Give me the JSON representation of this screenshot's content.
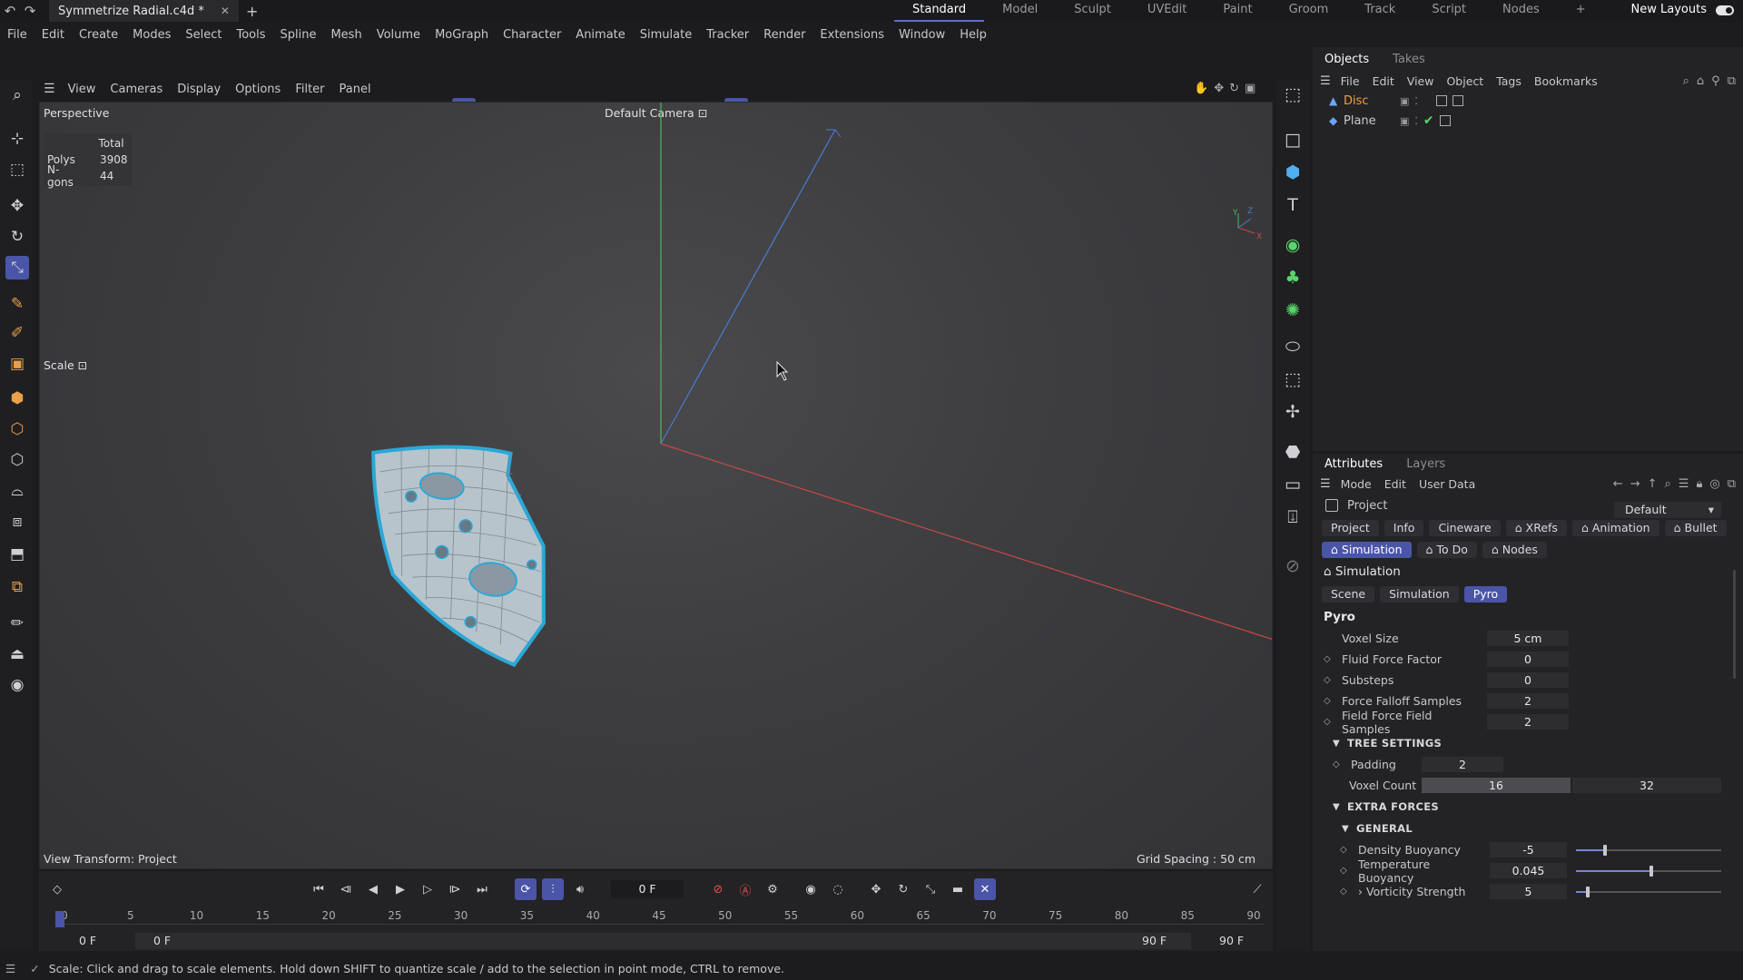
{
  "window": {
    "doc_tab": "Symmetrize Radial.c4d *",
    "layouts": [
      "Standard",
      "Model",
      "Sculpt",
      "UVEdit",
      "Paint",
      "Groom",
      "Track",
      "Script",
      "Nodes"
    ],
    "active_layout": "Standard",
    "new_layouts": "New Layouts"
  },
  "menu": [
    "File",
    "Edit",
    "Create",
    "Modes",
    "Select",
    "Tools",
    "Spline",
    "Mesh",
    "Volume",
    "MoGraph",
    "Character",
    "Animate",
    "Simulate",
    "Tracker",
    "Render",
    "Extensions",
    "Window",
    "Help"
  ],
  "toolbar": {
    "axis_x": "X",
    "axis_y": "Y",
    "axis_z": "Z"
  },
  "viewport": {
    "menu": [
      "View",
      "Cameras",
      "Display",
      "Options",
      "Filter",
      "Panel"
    ],
    "name": "Perspective",
    "camera": "Default Camera",
    "stats_header": "Total",
    "stats": [
      {
        "label": "Polys",
        "value": "3908"
      },
      {
        "label": "N-gons",
        "value": "44"
      }
    ],
    "tool_label": "Scale",
    "view_transform": "View Transform: Project",
    "grid_spacing": "Grid Spacing : 50 cm",
    "axis_labels": {
      "y": "Y",
      "z": "Z",
      "x": "X"
    }
  },
  "objects_panel": {
    "tabs": [
      "Objects",
      "Takes"
    ],
    "menu": [
      "File",
      "Edit",
      "View",
      "Object",
      "Tags",
      "Bookmarks"
    ],
    "items": [
      {
        "name": "Disc",
        "color": "#f0a040"
      },
      {
        "name": "Plane",
        "color": "#c8c8cc"
      }
    ]
  },
  "attributes": {
    "tabs": [
      "Attributes",
      "Layers"
    ],
    "menu": [
      "Mode",
      "Edit",
      "User Data"
    ],
    "object": "Project",
    "preset": "Default",
    "row1": [
      "Project",
      "Info",
      "Cineware",
      "XRefs",
      "Animation",
      "Bullet"
    ],
    "row2": [
      "Simulation",
      "To Do",
      "Nodes"
    ],
    "section": "Simulation",
    "subtabs": [
      "Scene",
      "Simulation",
      "Pyro"
    ],
    "subsection": "Pyro",
    "params": [
      {
        "label": "Voxel Size",
        "value": "5 cm"
      },
      {
        "label": "Fluid Force Factor",
        "value": "0"
      },
      {
        "label": "Substeps",
        "value": "0"
      },
      {
        "label": "Force Falloff Samples",
        "value": "2"
      },
      {
        "label": "Field Force Field Samples",
        "value": "2"
      }
    ],
    "tree_settings": "TREE SETTINGS",
    "padding": {
      "label": "Padding",
      "value": "2"
    },
    "voxel_count": {
      "label": "Voxel Count",
      "value": "16",
      "max": "32"
    },
    "extra_forces": "EXTRA FORCES",
    "general": "GENERAL",
    "forces": [
      {
        "label": "Density Buoyancy",
        "value": "-5",
        "level": 0.2
      },
      {
        "label": "Temperature Buoyancy",
        "value": "0.045",
        "level": 0.52
      },
      {
        "label": "Vorticity Strength",
        "value": "5",
        "level": 0.08
      }
    ],
    "accent": "#4a55a8"
  },
  "timeline": {
    "current_frame": "0 F",
    "ticks": [
      "0",
      "5",
      "10",
      "15",
      "20",
      "25",
      "30",
      "35",
      "40",
      "45",
      "50",
      "55",
      "60",
      "65",
      "70",
      "75",
      "80",
      "85",
      "90"
    ],
    "start": "0 F",
    "start2": "0 F",
    "end": "90 F",
    "end2": "90 F"
  },
  "status": "Scale: Click and drag to scale elements. Hold down SHIFT to quantize scale / add to the selection in point mode, CTRL to remove."
}
